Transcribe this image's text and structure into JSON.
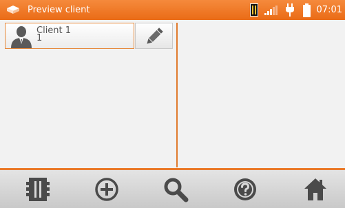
{
  "header": {
    "title": "Preview client",
    "time": "07:01"
  },
  "clients": [
    {
      "name": "Client 1",
      "id": "1"
    }
  ],
  "toolbar": {
    "buttons": [
      "memory-icon",
      "add-icon",
      "search-icon",
      "help-icon",
      "home-icon"
    ]
  },
  "colors": {
    "accent": "#ea6b16",
    "text": "#555555",
    "toolbar_icon": "#4a4a4a"
  }
}
